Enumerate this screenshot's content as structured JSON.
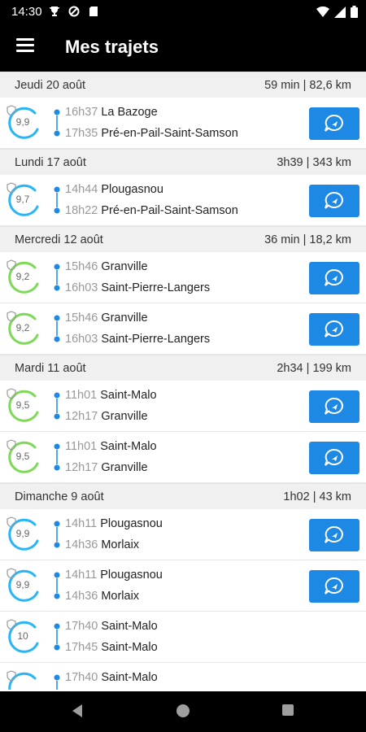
{
  "status": {
    "time": "14:30"
  },
  "appbar": {
    "title": "Mes trajets"
  },
  "colors": {
    "blue": "#1e88e5",
    "green": "#7ed957",
    "cyan": "#29b6f6"
  },
  "days": [
    {
      "date": "Jeudi 20 août",
      "summary": "59 min | 82,6 km",
      "trips": [
        {
          "score": "9,9",
          "color": "cyan",
          "dep_time": "16h37",
          "dep_place": "La Bazoge",
          "arr_time": "17h35",
          "arr_place": "Pré-en-Pail-Saint-Samson",
          "chat": true
        }
      ]
    },
    {
      "date": "Lundi 17 août",
      "summary": "3h39 | 343 km",
      "trips": [
        {
          "score": "9,7",
          "color": "cyan",
          "dep_time": "14h44",
          "dep_place": "Plougasnou",
          "arr_time": "18h22",
          "arr_place": "Pré-en-Pail-Saint-Samson",
          "chat": true
        }
      ]
    },
    {
      "date": "Mercredi 12 août",
      "summary": "36 min | 18,2 km",
      "trips": [
        {
          "score": "9,2",
          "color": "green",
          "dep_time": "15h46",
          "dep_place": "Granville",
          "arr_time": "16h03",
          "arr_place": "Saint-Pierre-Langers",
          "chat": true
        },
        {
          "score": "9,2",
          "color": "green",
          "dep_time": "15h46",
          "dep_place": "Granville",
          "arr_time": "16h03",
          "arr_place": "Saint-Pierre-Langers",
          "chat": true
        }
      ]
    },
    {
      "date": "Mardi 11 août",
      "summary": "2h34 | 199 km",
      "trips": [
        {
          "score": "9,5",
          "color": "green",
          "dep_time": "11h01",
          "dep_place": "Saint-Malo",
          "arr_time": "12h17",
          "arr_place": "Granville",
          "chat": true
        },
        {
          "score": "9,5",
          "color": "green",
          "dep_time": "11h01",
          "dep_place": "Saint-Malo",
          "arr_time": "12h17",
          "arr_place": "Granville",
          "chat": true
        }
      ]
    },
    {
      "date": "Dimanche 9 août",
      "summary": "1h02 | 43 km",
      "trips": [
        {
          "score": "9,9",
          "color": "cyan",
          "dep_time": "14h11",
          "dep_place": "Plougasnou",
          "arr_time": "14h36",
          "arr_place": "Morlaix",
          "chat": true
        },
        {
          "score": "9,9",
          "color": "cyan",
          "dep_time": "14h11",
          "dep_place": "Plougasnou",
          "arr_time": "14h36",
          "arr_place": "Morlaix",
          "chat": true
        },
        {
          "score": "10",
          "color": "cyan",
          "dep_time": "17h40",
          "dep_place": "Saint-Malo",
          "arr_time": "17h45",
          "arr_place": "Saint-Malo",
          "chat": false
        },
        {
          "score": "",
          "color": "cyan",
          "dep_time": "17h40",
          "dep_place": "Saint-Malo",
          "arr_time": "",
          "arr_place": "",
          "chat": false
        }
      ]
    }
  ]
}
